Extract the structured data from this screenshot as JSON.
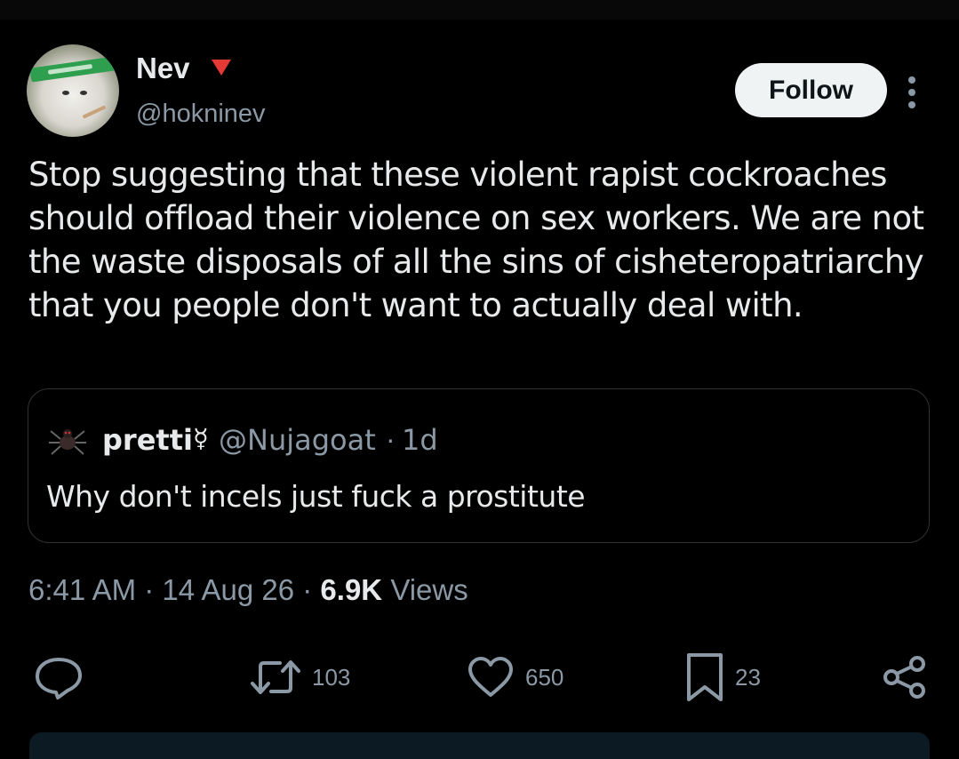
{
  "author": {
    "name": "Nev",
    "handle": "@hokninev",
    "badge_color": "#e53935",
    "avatar_icon": "cat-avatar"
  },
  "follow_button": {
    "label": "Follow"
  },
  "more_icon": "more-vertical-icon",
  "tweet": {
    "text": "Stop suggesting that these violent rapist cockroaches should offload their violence on sex workers. We are not the waste disposals of all the sins of cisheteropatriarchy that you people don't want to actually deal with."
  },
  "quoted": {
    "name": "pretti",
    "symbol": "☿",
    "handle": "@Nujagoat",
    "separator": "·",
    "time": "1d",
    "text": "Why don't incels just fuck a prostitute",
    "avatar_icon": "spider-avatar"
  },
  "meta": {
    "time": "6:41 AM",
    "dot1": "·",
    "date": "14 Aug 26",
    "dot2": "·",
    "views_count": "6.9K",
    "views_label": "Views"
  },
  "actions": {
    "reply": {
      "icon": "reply-icon"
    },
    "retweet": {
      "icon": "retweet-icon",
      "count": "103"
    },
    "like": {
      "icon": "heart-icon",
      "count": "650"
    },
    "bookmark": {
      "icon": "bookmark-icon",
      "count": "23"
    },
    "share": {
      "icon": "share-icon"
    }
  },
  "colors": {
    "background": "#000000",
    "text": "#e7e9ea",
    "muted": "#8b98a5",
    "border": "#2f3336"
  }
}
